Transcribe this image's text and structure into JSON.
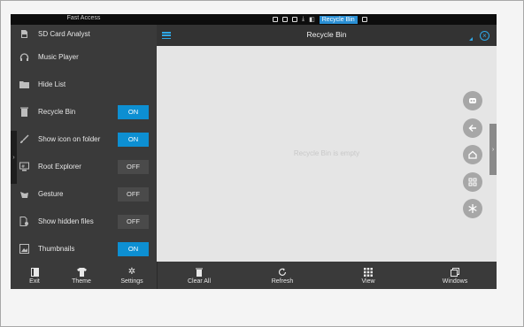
{
  "status_bar": {
    "left_label": "Fast Access",
    "active_tag": "Recycle Bin"
  },
  "sidebar": {
    "items": [
      {
        "label": "SD Card Analyst",
        "icon": "sd-card-icon"
      },
      {
        "label": "Music Player",
        "icon": "headphones-icon"
      },
      {
        "label": "Hide List",
        "icon": "folder-icon"
      },
      {
        "label": "Recycle Bin",
        "icon": "trash-icon",
        "toggle": "ON"
      },
      {
        "label": "Show icon on folder",
        "icon": "brush-icon",
        "toggle": "ON"
      },
      {
        "label": "Root Explorer",
        "icon": "root-explorer-icon",
        "toggle": "OFF"
      },
      {
        "label": "Gesture",
        "icon": "gesture-hand-icon",
        "toggle": "OFF"
      },
      {
        "label": "Show hidden files",
        "icon": "hidden-files-icon",
        "toggle": "OFF"
      },
      {
        "label": "Thumbnails",
        "icon": "image-icon",
        "toggle": "ON"
      }
    ],
    "edge_tab_glyph": "›"
  },
  "titlebar": {
    "title": "Recycle Bin",
    "close_glyph": "×"
  },
  "content": {
    "empty_message": "Recycle Bin is empty",
    "right_tab_glyph": "›",
    "fab_icons": [
      "transfer-icon",
      "back-arrow-icon",
      "home-icon",
      "grid-icon",
      "snowflake-icon"
    ]
  },
  "bottom_bar": {
    "sidebar_buttons": [
      {
        "label": "Exit",
        "icon": "exit-icon"
      },
      {
        "label": "Theme",
        "icon": "shirt-icon"
      },
      {
        "label": "Settings",
        "icon": "gear-icon"
      }
    ],
    "main_buttons": [
      {
        "label": "Clear All",
        "icon": "trash-icon"
      },
      {
        "label": "Refresh",
        "icon": "refresh-icon"
      },
      {
        "label": "View",
        "icon": "grid-view-icon"
      },
      {
        "label": "Windows",
        "icon": "windows-icon"
      }
    ]
  },
  "colors": {
    "accent": "#0d8fd2",
    "sidebar_bg": "#3a3a3a",
    "content_bg": "#e5e5e5"
  }
}
